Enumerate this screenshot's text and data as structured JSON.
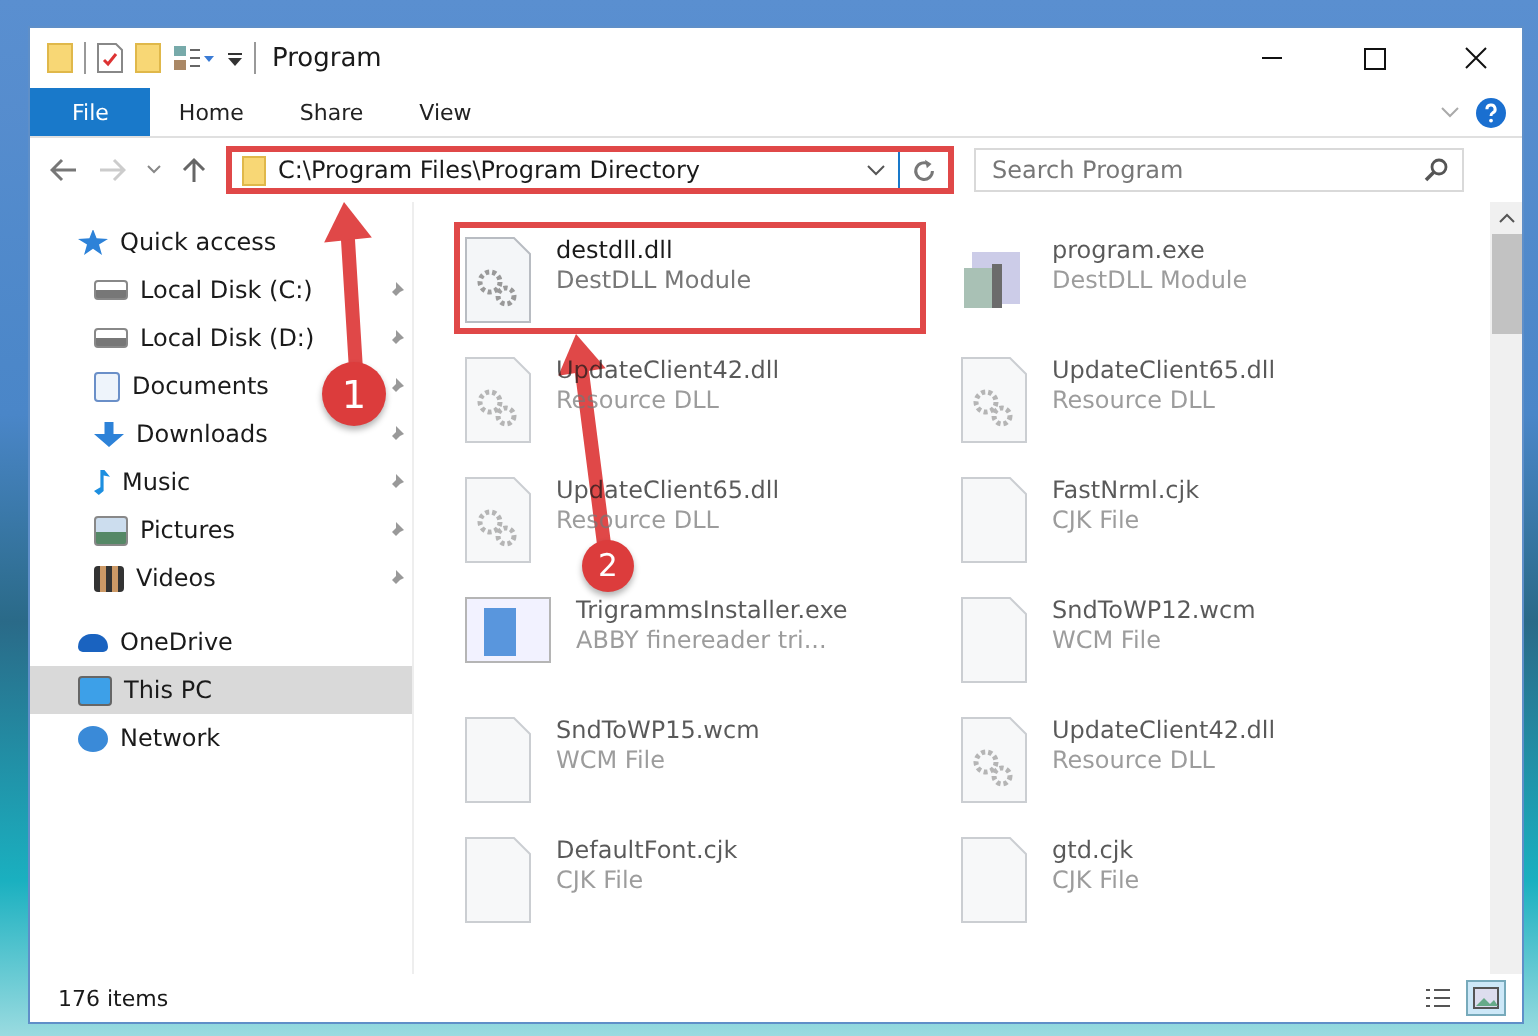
{
  "window": {
    "title": "Program"
  },
  "ribbon_tabs": [
    {
      "label": "File",
      "selected": true
    },
    {
      "label": "Home",
      "selected": false
    },
    {
      "label": "Share",
      "selected": false
    },
    {
      "label": "View",
      "selected": false
    }
  ],
  "address_bar": {
    "value": "C:\\Program Files\\Program Directory",
    "highlighted": true
  },
  "search": {
    "placeholder": "Search Program"
  },
  "sidebar": {
    "items": [
      {
        "label": "Quick access",
        "kind": "star",
        "selected": false,
        "children": [
          {
            "label": "Local Disk (C:)",
            "kind": "drive-win",
            "selected": false,
            "pinned": true
          },
          {
            "label": "Local Disk (D:)",
            "kind": "drive",
            "selected": false,
            "pinned": true
          },
          {
            "label": "Documents",
            "kind": "doc",
            "selected": false,
            "pinned": true
          },
          {
            "label": "Downloads",
            "kind": "download",
            "selected": false,
            "pinned": true
          },
          {
            "label": "Music",
            "kind": "music",
            "selected": false,
            "pinned": true
          },
          {
            "label": "Pictures",
            "kind": "picture",
            "selected": false,
            "pinned": true
          },
          {
            "label": "Videos",
            "kind": "video",
            "selected": false,
            "pinned": true
          }
        ]
      },
      {
        "label": "OneDrive",
        "kind": "cloud",
        "selected": false
      },
      {
        "label": "This PC",
        "kind": "pc",
        "selected": true
      },
      {
        "label": "Network",
        "kind": "network",
        "selected": false
      }
    ]
  },
  "files": [
    {
      "name": "destdll.dll",
      "type": "DestDLL Module",
      "kind": "gear",
      "highlighted": true,
      "blurred": false
    },
    {
      "name": "program.exe",
      "type": "DestDLL Module",
      "kind": "exe",
      "highlighted": false,
      "blurred": true
    },
    {
      "name": "UpdateClient42.dll",
      "type": "Resource DLL",
      "kind": "gear",
      "highlighted": false,
      "blurred": true
    },
    {
      "name": "UpdateClient65.dll",
      "type": "Resource DLL",
      "kind": "gear",
      "highlighted": false,
      "blurred": true
    },
    {
      "name": "UpdateClient65.dll",
      "type": "Resource DLL",
      "kind": "gear",
      "highlighted": false,
      "blurred": true
    },
    {
      "name": "FastNrml.cjk",
      "type": "CJK File",
      "kind": "blank",
      "highlighted": false,
      "blurred": true
    },
    {
      "name": "TrigrammsInstaller.exe",
      "type": "ABBY finereader tri...",
      "kind": "installer",
      "highlighted": false,
      "blurred": true
    },
    {
      "name": "SndToWP12.wcm",
      "type": "WCM File",
      "kind": "blank",
      "highlighted": false,
      "blurred": true
    },
    {
      "name": "SndToWP15.wcm",
      "type": "WCM File",
      "kind": "blank",
      "highlighted": false,
      "blurred": true
    },
    {
      "name": "UpdateClient42.dll",
      "type": "Resource DLL",
      "kind": "gear",
      "highlighted": false,
      "blurred": true
    },
    {
      "name": "DefaultFont.cjk",
      "type": "CJK File",
      "kind": "blank",
      "highlighted": false,
      "blurred": true
    },
    {
      "name": "gtd.cjk",
      "type": "CJK File",
      "kind": "blank",
      "highlighted": false,
      "blurred": true
    }
  ],
  "status_bar": {
    "item_count": "176 items",
    "views": [
      {
        "kind": "details",
        "selected": false
      },
      {
        "kind": "large-icons",
        "selected": true
      }
    ]
  },
  "annotations": [
    {
      "number": "1"
    },
    {
      "number": "2"
    }
  ]
}
